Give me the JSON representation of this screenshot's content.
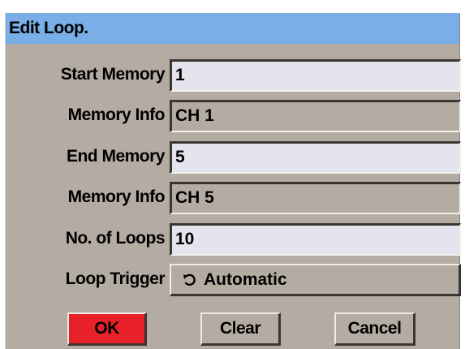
{
  "dialog": {
    "title": "Edit Loop."
  },
  "rows": [
    {
      "label": "Start Memory",
      "value": "1"
    },
    {
      "label": "Memory Info",
      "value": "CH 1"
    },
    {
      "label": "End Memory",
      "value": "5"
    },
    {
      "label": "Memory Info",
      "value": "CH 5"
    },
    {
      "label": "No. of Loops",
      "value": "10"
    },
    {
      "label": "Loop Trigger",
      "value": "Automatic"
    }
  ],
  "buttons": {
    "ok": "OK",
    "clear": "Clear",
    "cancel": "Cancel"
  },
  "colors": {
    "titlebar": "#7aaee6",
    "dialog_bg": "#b4aca3",
    "editable_field": "#e4e4ee",
    "ok_button": "#e8202a"
  },
  "icons": {
    "trigger": "cycle-arrow-icon"
  }
}
